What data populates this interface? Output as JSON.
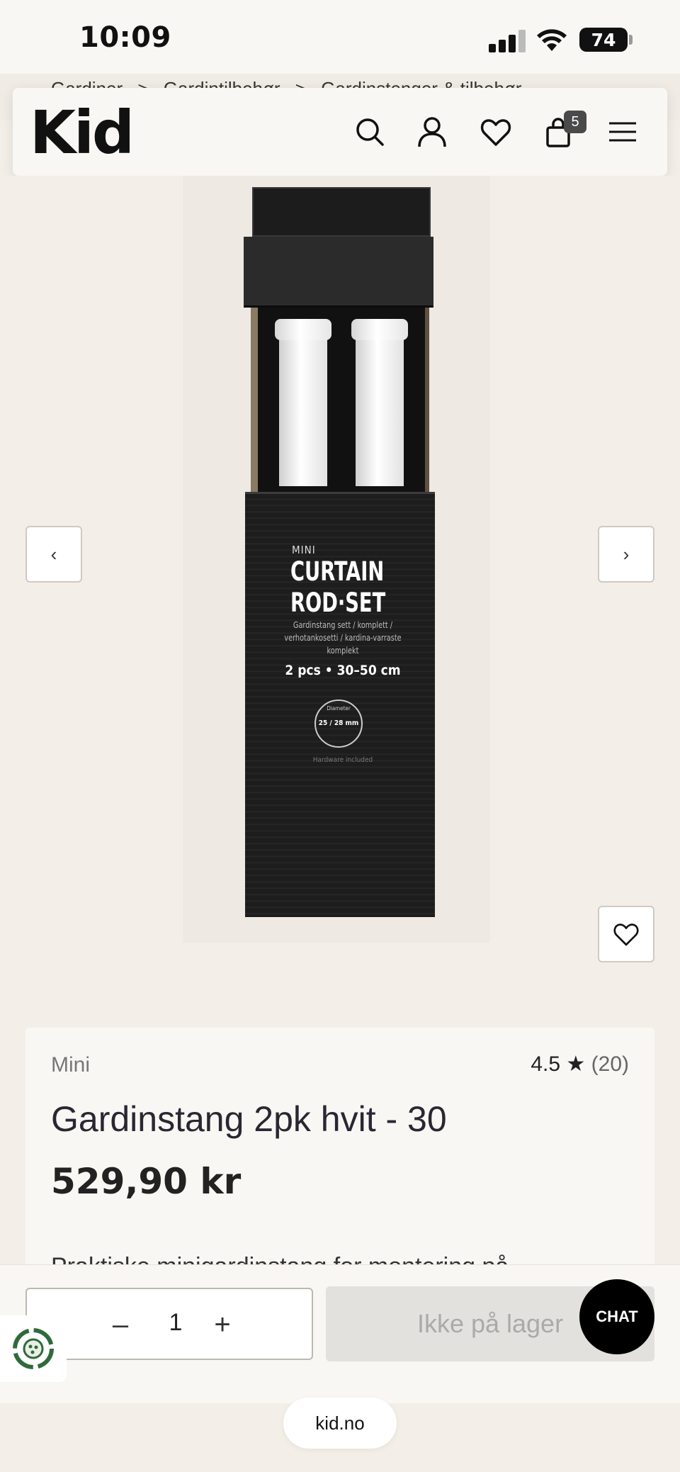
{
  "status_bar": {
    "time": "10:09",
    "battery": "74"
  },
  "breadcrumb": [
    "Gardiner",
    ">",
    "Gardintilbehør",
    ">",
    "Gardinstenger & tilbehør"
  ],
  "header": {
    "logo": "Kid",
    "cart_count": "5"
  },
  "product_image": {
    "box_mini": "MINI",
    "box_title_1": "CURTAIN",
    "box_title_2": "ROD·SET",
    "box_subtitle": "Gardinstang sett / komplett / verhotankosetti / kardina-varraste komplekt",
    "box_size": "2 pcs • 30–50 cm",
    "box_diameter_label": "Diameter",
    "box_diameter": "25 / 28 mm",
    "box_hardware": "Hardware included",
    "prev_glyph": "‹",
    "next_glyph": "›"
  },
  "product": {
    "brand": "Mini",
    "rating": "4.5",
    "rating_star": "★",
    "rating_count": "(20)",
    "title": "Gardinstang 2pk hvit - 30",
    "price": "529,90 kr",
    "description_peek": "Praktiske minigardinstang for montering på"
  },
  "buy_bar": {
    "minus": "–",
    "quantity": "1",
    "plus": "+",
    "add_to_cart_label": "Ikke på lager",
    "chat_label": "CHAT"
  },
  "browser": {
    "url": "kid.no"
  },
  "icons": [
    "search-icon",
    "user-icon",
    "heart-icon",
    "cart-icon",
    "menu-icon",
    "chevron-left-icon",
    "chevron-right-icon",
    "recycle-icon"
  ]
}
